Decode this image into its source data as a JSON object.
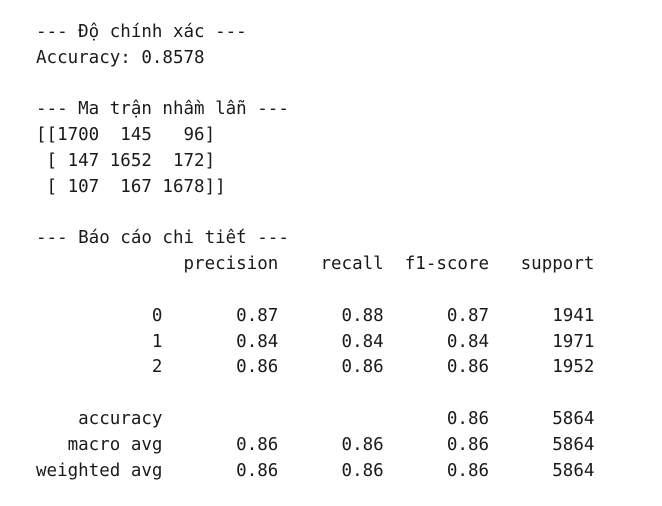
{
  "output": {
    "accuracy_header": "--- Độ chính xác ---",
    "accuracy_line": "Accuracy: 0.8578",
    "confusion_header": "--- Ma trận nhầm lẫn ---",
    "confusion_rows": [
      "[[1700  145   96]",
      " [ 147 1652  172]",
      " [ 107  167 1678]]"
    ],
    "report_header": "--- Báo cáo chi tiết ---",
    "report_columns": "              precision    recall  f1-score   support",
    "report_rows": [
      "           0       0.87      0.88      0.87      1941",
      "           1       0.84      0.84      0.84      1971",
      "           2       0.86      0.86      0.86      1952"
    ],
    "report_summary": [
      "    accuracy                           0.86      5864",
      "   macro avg       0.86      0.86      0.86      5864",
      "weighted avg       0.86      0.86      0.86      5864"
    ]
  }
}
